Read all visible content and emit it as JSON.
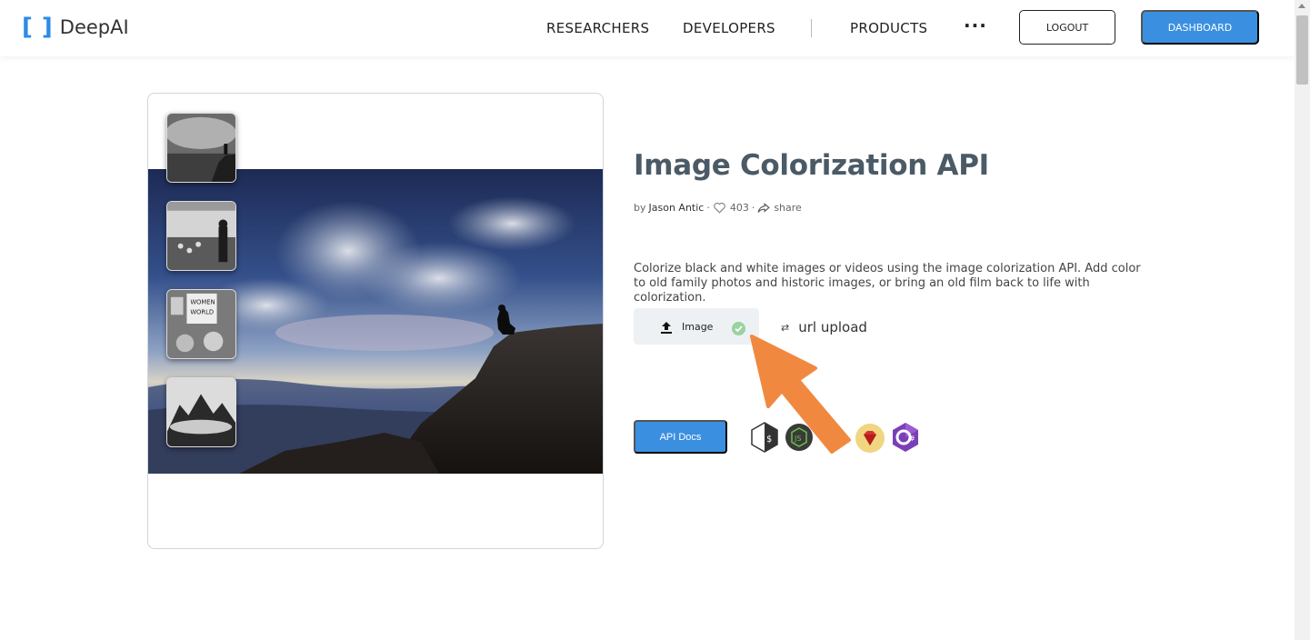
{
  "header": {
    "logo_bracket_left": "[",
    "logo_bracket_right": "]",
    "logo_text": "DeepAI",
    "nav": [
      "RESEARCHERS",
      "DEVELOPERS",
      "PRODUCTS"
    ],
    "more": "···",
    "logout_label": "LOGOUT",
    "dashboard_label": "DASHBOARD"
  },
  "content": {
    "title": "Image Colorization API",
    "by": "by",
    "author": "Jason Antic",
    "likes": "403",
    "share": "share",
    "description": "Colorize black and white images or videos using the image colorization API. Add color to old family photos and historic images, or bring an old film back to life with colorization.",
    "upload_label": "Image",
    "url_upload_label": "url upload",
    "api_docs_label": "API Docs"
  },
  "icons": [
    "shell-icon",
    "nodejs-icon",
    "ruby-icon",
    "csharp-icon",
    "heart-icon",
    "share-icon",
    "upload-icon",
    "check-icon",
    "swap-icon"
  ],
  "colors": {
    "brand_blue": "#3b8fe0",
    "arrow_orange": "#f0893f",
    "title_gray": "#4a5a66"
  }
}
